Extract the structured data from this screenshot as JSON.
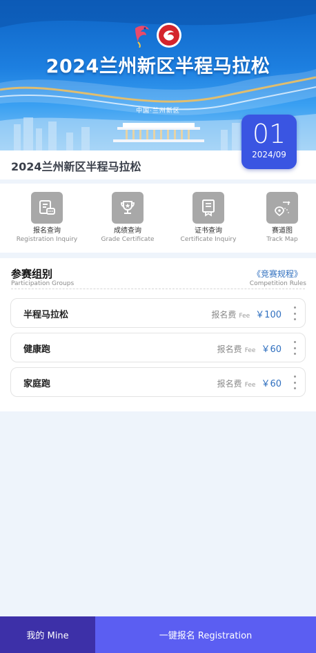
{
  "banner": {
    "title": "2024兰州新区半程马拉松",
    "subtitle": "中国·兰州新区"
  },
  "date_badge": {
    "day": "01",
    "year_month": "2024/09",
    "color": "#3a55e2"
  },
  "event": {
    "name": "2024兰州新区半程马拉松"
  },
  "features": [
    {
      "icon": "registration-message-icon",
      "label_cn": "报名查询",
      "label_en": "Registration Inquiry"
    },
    {
      "icon": "trophy-icon",
      "label_cn": "成绩查询",
      "label_en": "Grade Certificate"
    },
    {
      "icon": "certificate-icon",
      "label_cn": "证书查询",
      "label_en": "Certificate Inquiry"
    },
    {
      "icon": "map-pin-icon",
      "label_cn": "赛道图",
      "label_en": "Track Map"
    }
  ],
  "groups_section": {
    "title": "参赛组别",
    "subtitle": "Participation Groups",
    "rules_link": "《竞赛规程》",
    "rules_sub": "Competition Rules",
    "items": [
      {
        "name": "半程马拉松",
        "fee_label": "报名费",
        "fee_en": "Fee",
        "price": "￥100"
      },
      {
        "name": "健康跑",
        "fee_label": "报名费",
        "fee_en": "Fee",
        "price": "￥60"
      },
      {
        "name": "家庭跑",
        "fee_label": "报名费",
        "fee_en": "Fee",
        "price": "￥60"
      }
    ]
  },
  "bottom_nav": {
    "mine": "我的 Mine",
    "register": "一键报名 Registration"
  },
  "colors": {
    "accent": "#2f6fbf",
    "nav_dark": "#3d30a8",
    "nav_primary": "#5b5ef2",
    "icon_bg": "#a8a8a8"
  }
}
